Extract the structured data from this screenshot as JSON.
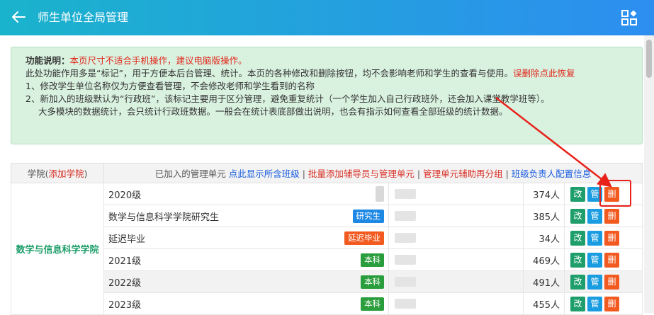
{
  "header": {
    "title": "师生单位全局管理"
  },
  "notice": {
    "label": "功能说明：",
    "warn": "本页尺寸不适合手机操作，建议电脑版操作。",
    "line2": "此处功能作用多是“标记”，用于方便本后台管理、统计。本页的各种修改和删除按钮，均不会影响老师和学生的查看与使用。",
    "restore": "误删除点此恢复",
    "item1": "1、修改学生单位名称仅为方便查看管理，不会修改老师和学生看到的名称",
    "item2": "2、新加入的班级默认为“行政班”，该标记主要用于区分管理，避免重复统计（一个学生加入自己行政班外，还会加入课堂教学班等）。",
    "item3": "大多模块的数据统计，会只统计行政班数据。一般会在统计表底部做出说明，也会有指示如何查看全部班级的统计数据。"
  },
  "table": {
    "h_college": "学院",
    "h_add_college": "添加学院",
    "h_units": "已加入的管理单元",
    "h_show_all": "点此显示所含班级",
    "h_batch": "批量添加辅导员与管理单元",
    "h_regroup": "管理单元辅助再分组",
    "h_config": "班级负责人配置信息",
    "college": "数学与信息科学学院",
    "rows": [
      {
        "name": "2020级",
        "tag": "",
        "count": "374人"
      },
      {
        "name": "数学与信息科学学院研究生",
        "tag": "研究生",
        "count": "385人"
      },
      {
        "name": "延迟毕业",
        "tag": "延迟毕业",
        "count": "34人"
      },
      {
        "name": "2021级",
        "tag": "本科",
        "count": "469人"
      },
      {
        "name": "2022级",
        "tag": "本科",
        "count": "491人"
      },
      {
        "name": "2023级",
        "tag": "本科",
        "count": "455人"
      }
    ],
    "op_edit": "改",
    "op_manage": "管",
    "op_delete": "删"
  },
  "colors": {
    "accent": "#2d8ef0",
    "danger": "#f25a20",
    "success": "#1e9e6a"
  },
  "icons": {
    "back": "arrow-left-icon",
    "menu": "grid-menu-icon"
  }
}
